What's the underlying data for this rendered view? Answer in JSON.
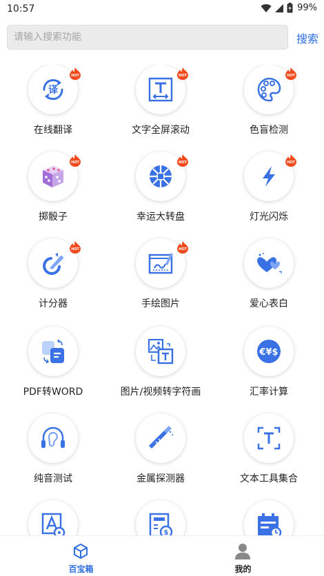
{
  "status_bar": {
    "time": "10:57",
    "battery": "99%"
  },
  "search": {
    "placeholder": "请输入搜索功能",
    "button_label": "搜索"
  },
  "hot_label": "HOT",
  "tools": [
    {
      "label": "在线翻译",
      "hot": true,
      "icon": "translate-icon"
    },
    {
      "label": "文字全屏滚动",
      "hot": true,
      "icon": "text-scroll-icon"
    },
    {
      "label": "色盲检测",
      "hot": true,
      "icon": "palette-icon"
    },
    {
      "label": "掷骰子",
      "hot": true,
      "icon": "dice-icon"
    },
    {
      "label": "幸运大转盘",
      "hot": true,
      "icon": "wheel-icon"
    },
    {
      "label": "灯光闪烁",
      "hot": true,
      "icon": "lightning-icon"
    },
    {
      "label": "计分器",
      "hot": true,
      "icon": "score-icon"
    },
    {
      "label": "手绘图片",
      "hot": true,
      "icon": "drawing-icon"
    },
    {
      "label": "爱心表白",
      "hot": false,
      "icon": "hearts-icon"
    },
    {
      "label": "PDF转WORD",
      "hot": false,
      "icon": "pdf-convert-icon"
    },
    {
      "label": "图片/视频转字符画",
      "hot": false,
      "icon": "image-to-text-icon"
    },
    {
      "label": "汇率计算",
      "hot": false,
      "icon": "currency-icon"
    },
    {
      "label": "纯音测试",
      "hot": false,
      "icon": "headphones-icon"
    },
    {
      "label": "金属探测器",
      "hot": false,
      "icon": "metal-detector-icon"
    },
    {
      "label": "文本工具集合",
      "hot": false,
      "icon": "text-tools-icon"
    },
    {
      "label": "",
      "hot": false,
      "icon": "font-settings-icon"
    },
    {
      "label": "",
      "hot": false,
      "icon": "bill-calculator-icon"
    },
    {
      "label": "",
      "hot": false,
      "icon": "calendar-icon"
    }
  ],
  "tab_bar": {
    "tabs": [
      {
        "label": "百宝箱",
        "icon": "cube-icon",
        "active": true
      },
      {
        "label": "我的",
        "icon": "user-icon",
        "active": false
      }
    ]
  },
  "colors": {
    "accent": "#2e6fe0",
    "icon_blue": "#3a72e6",
    "hot_red": "#f24a1d",
    "tab_inactive": "#222222"
  }
}
